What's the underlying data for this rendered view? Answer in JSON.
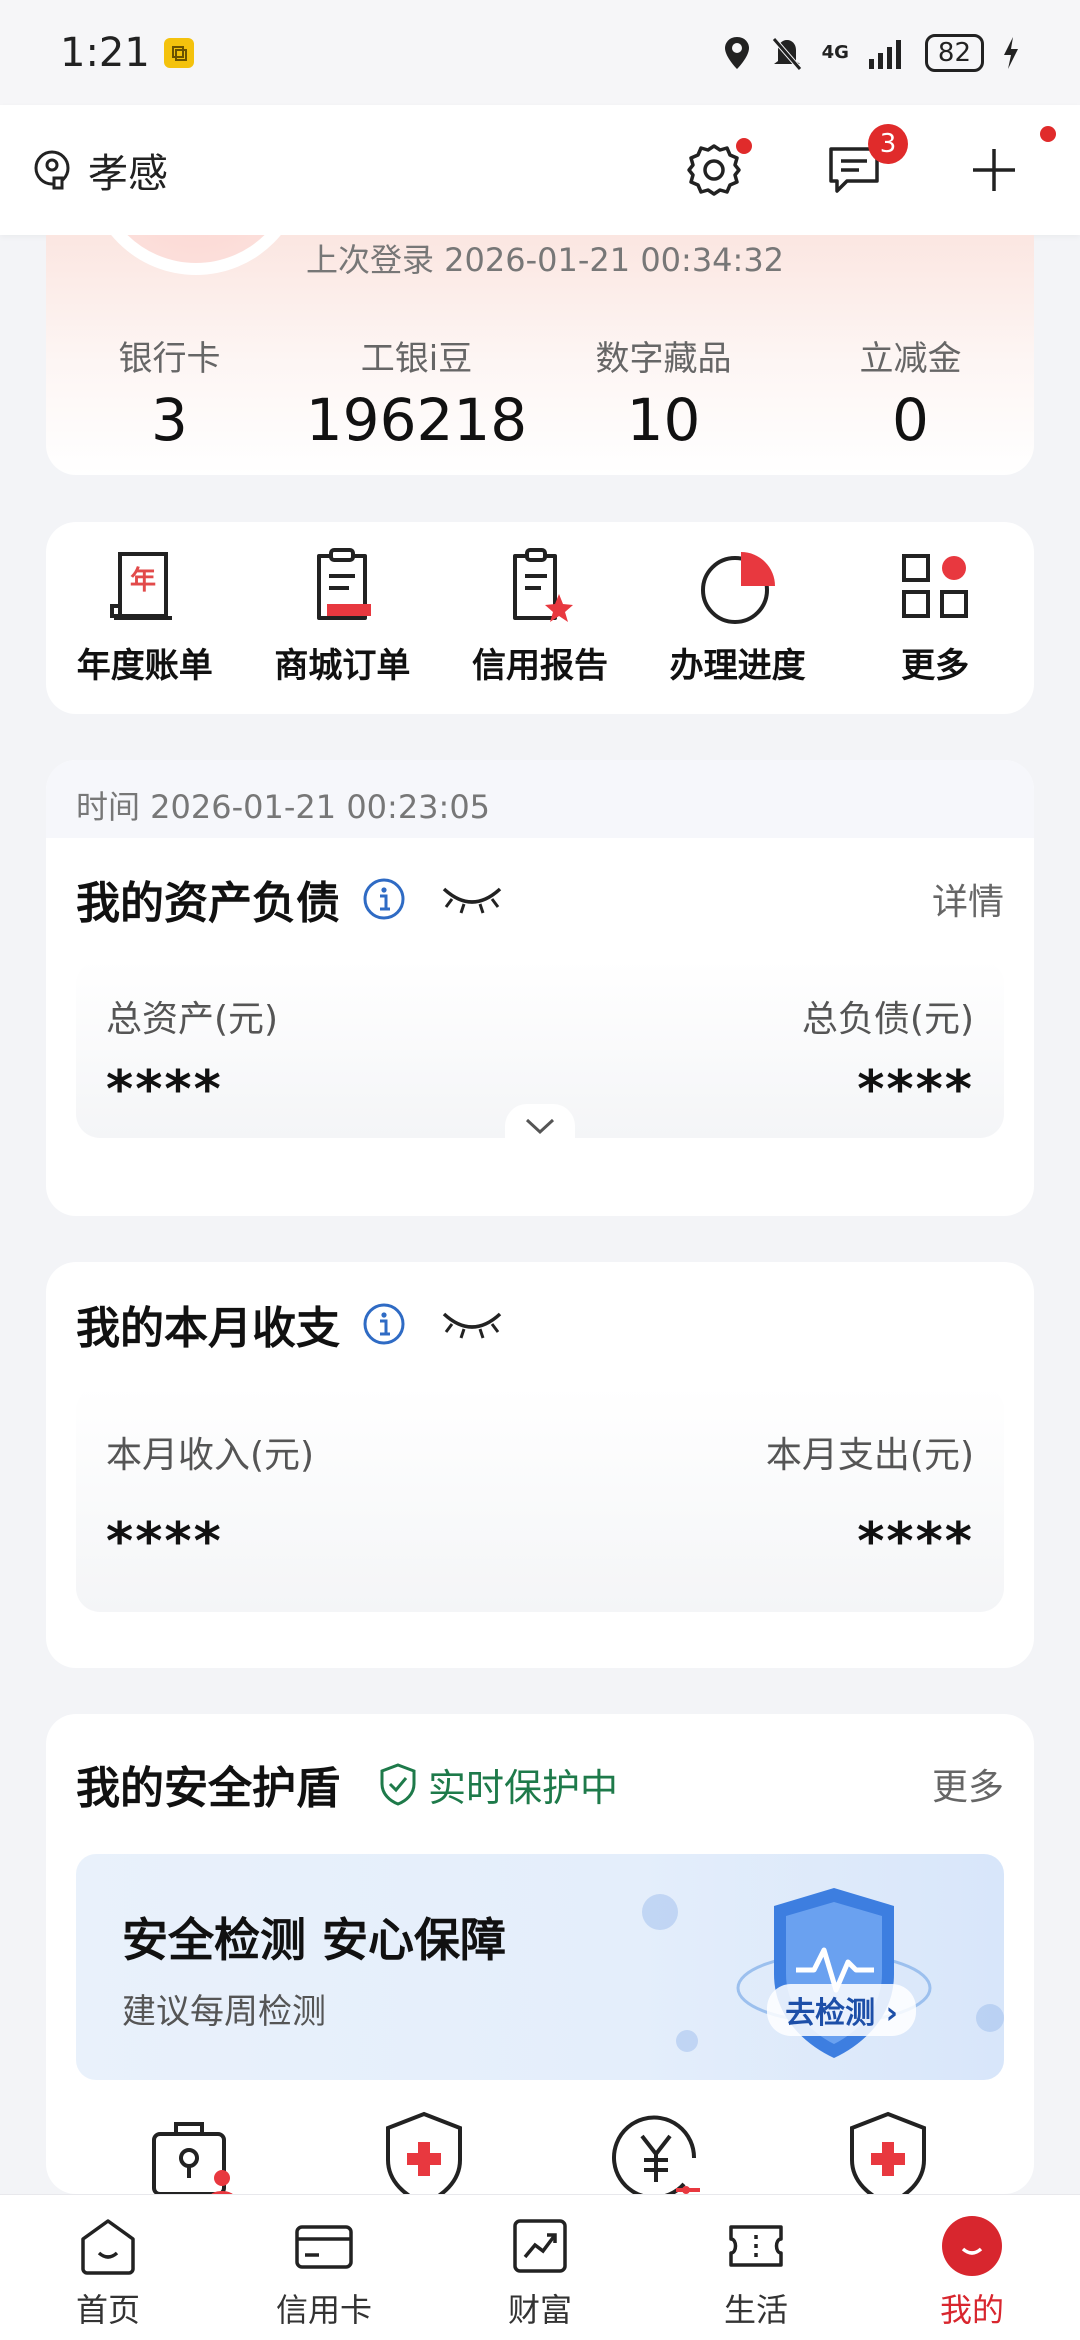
{
  "status_bar": {
    "time": "1:21",
    "network": "4G",
    "battery": "82"
  },
  "header": {
    "location": "孝感",
    "messages_badge": "3"
  },
  "profile": {
    "last_login": "上次登录 2026-01-21 00:34:32",
    "stats": [
      {
        "label": "银行卡",
        "value": "3"
      },
      {
        "label": "工银i豆",
        "value": "196218"
      },
      {
        "label": "数字藏品",
        "value": "10"
      },
      {
        "label": "立减金",
        "value": "0"
      }
    ]
  },
  "quick_menu": [
    {
      "label": "年度账单",
      "icon": "annual-bill-icon"
    },
    {
      "label": "商城订单",
      "icon": "mall-order-icon"
    },
    {
      "label": "信用报告",
      "icon": "credit-report-icon"
    },
    {
      "label": "办理进度",
      "icon": "progress-icon"
    },
    {
      "label": "更多",
      "icon": "more-grid-icon"
    }
  ],
  "assets": {
    "time": "时间 2026-01-21 00:23:05",
    "title": "我的资产负债",
    "detail_link": "详情",
    "total_assets_label": "总资产(元)",
    "total_debt_label": "总负债(元)",
    "total_assets_value": "****",
    "total_debt_value": "****"
  },
  "income": {
    "title": "我的本月收支",
    "income_label": "本月收入(元)",
    "expense_label": "本月支出(元)",
    "income_value": "****",
    "expense_value": "****"
  },
  "shield": {
    "title": "我的安全护盾",
    "status": "实时保护中",
    "more_link": "更多",
    "banner_title": "安全检测 安心保障",
    "banner_subtitle": "建议每周检测",
    "detect_button": "去检测"
  },
  "bottom_nav": [
    {
      "label": "首页",
      "icon": "home-icon"
    },
    {
      "label": "信用卡",
      "icon": "credit-card-icon"
    },
    {
      "label": "财富",
      "icon": "wealth-icon"
    },
    {
      "label": "生活",
      "icon": "life-ticket-icon"
    },
    {
      "label": "我的",
      "icon": "profile-icon",
      "active": true
    }
  ],
  "colors": {
    "accent_red": "#d8262e",
    "protect_green": "#1e7a4a",
    "info_blue": "#2f6bc4"
  }
}
